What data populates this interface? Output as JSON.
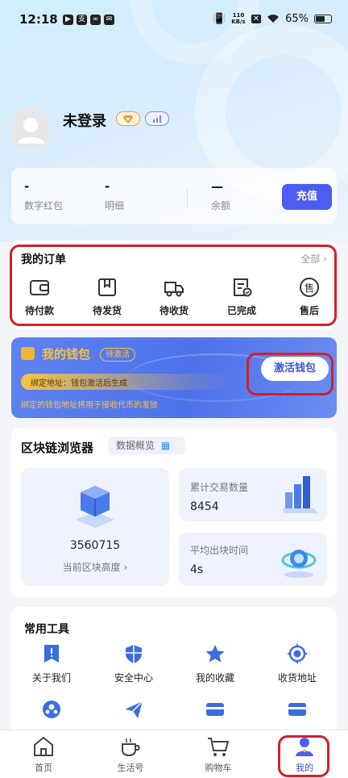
{
  "status_bar": {
    "time": "12:18",
    "speed_value": "110",
    "speed_unit": "KB/s",
    "battery": "65%",
    "battery_level": 0.65
  },
  "profile": {
    "username": "未登录"
  },
  "balance": {
    "items": [
      {
        "value": "-",
        "label": "数字红包"
      },
      {
        "value": "-",
        "label": "明细"
      },
      {
        "value": "—",
        "label": "余额"
      }
    ],
    "recharge_label": "充值"
  },
  "orders": {
    "title": "我的订单",
    "all_label": "全部",
    "items": [
      {
        "label": "待付款",
        "icon": "wallet-icon"
      },
      {
        "label": "待发货",
        "icon": "package-icon"
      },
      {
        "label": "待收货",
        "icon": "truck-icon"
      },
      {
        "label": "已完成",
        "icon": "clipboard-check-icon"
      },
      {
        "label": "售后",
        "icon": "after-sale-icon"
      }
    ]
  },
  "wallet": {
    "title": "我的钱包",
    "status": "待激活",
    "bind_text": "绑定地址：钱包激活后生成",
    "note": "绑定的钱包地址将用于接收代币的发放",
    "activate_label": "激活钱包"
  },
  "blockchain": {
    "title": "区块链浏览器",
    "overview_label": "数据概览",
    "block_height": "3560715",
    "block_height_label": "当前区块高度",
    "total_tx_label": "累计交易数量",
    "total_tx_value": "8454",
    "avg_block_time_label": "平均出块时间",
    "avg_block_time_value": "4s"
  },
  "tools": {
    "title": "常用工具",
    "items": [
      {
        "label": "关于我们",
        "icon": "bookmark-alert-icon"
      },
      {
        "label": "安全中心",
        "icon": "shield-icon"
      },
      {
        "label": "我的收藏",
        "icon": "star-icon"
      },
      {
        "label": "收货地址",
        "icon": "location-icon"
      }
    ]
  },
  "tabbar": {
    "items": [
      {
        "label": "首页",
        "icon": "home-icon"
      },
      {
        "label": "生活号",
        "icon": "coffee-icon"
      },
      {
        "label": "购物车",
        "icon": "cart-icon"
      },
      {
        "label": "我的",
        "icon": "profile-icon",
        "active": true
      }
    ]
  },
  "colors": {
    "accent": "#4c5ef0",
    "highlight": "#d41f2b",
    "wallet_gold": "#f6c244"
  }
}
